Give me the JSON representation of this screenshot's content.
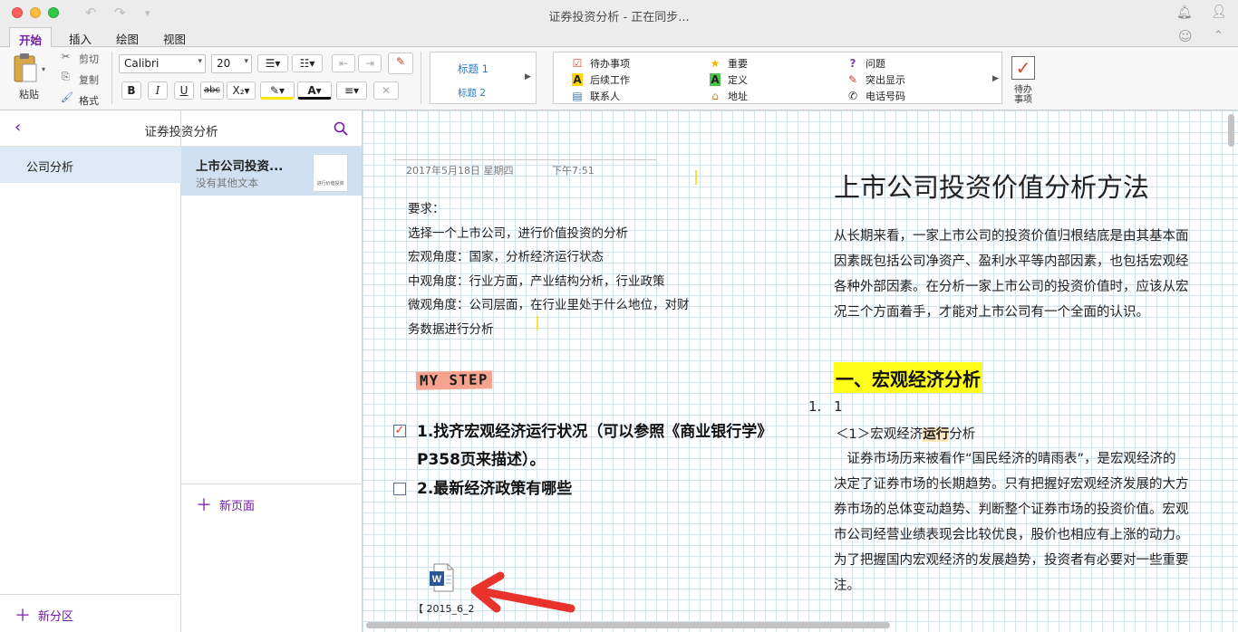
{
  "window": {
    "title": "证券投资分析 - 正在同步..."
  },
  "ribbon_tabs": [
    "开始",
    "插入",
    "绘图",
    "视图"
  ],
  "ribbon": {
    "paste": "粘贴",
    "cut": "剪切",
    "copy": "复制",
    "format": "格式",
    "font": "Calibri",
    "font_size": "20",
    "styles": [
      "标题 1",
      "标题 2"
    ],
    "tags": [
      {
        "icon": "checkbox-icon",
        "label": "待办事项"
      },
      {
        "icon": "star-icon",
        "label": "重要"
      },
      {
        "icon": "question-icon",
        "label": "问题"
      },
      {
        "icon": "letter-a-icon",
        "label": "后续工作"
      },
      {
        "icon": "letter-a-green-icon",
        "label": "定义"
      },
      {
        "icon": "highlighter-icon",
        "label": "突出显示"
      },
      {
        "icon": "contact-card-icon",
        "label": "联系人"
      },
      {
        "icon": "house-icon",
        "label": "地址"
      },
      {
        "icon": "phone-icon",
        "label": "电话号码"
      }
    ],
    "todo_button": "待办事项"
  },
  "nav": {
    "notebook": "证券投资分析",
    "sections": [
      "公司分析"
    ],
    "pages": [
      {
        "title": "上市公司投资...",
        "subtitle": "没有其他文本",
        "thumb": "进行价值投资"
      }
    ],
    "add_section": "新分区",
    "add_page": "新页面"
  },
  "page": {
    "date": "2017年5月18日 星期四",
    "time": "下午7:51",
    "requirements": [
      "要求：",
      "选择一个上市公司，进行价值投资的分析",
      "宏观角度：国家，分析经济运行状态",
      "中观角度：行业方面，产业结构分析，行业政策",
      "微观角度：公司层面，在行业里处于什么地位，对财",
      "务数据进行分析"
    ],
    "mystep": "MY STEP",
    "todos": [
      {
        "checked": true,
        "text": "1.找齐宏观经济运行状况（可以参照《商业银行学》P358页来描述）。"
      },
      {
        "checked": false,
        "text": "2.最新经济政策有哪些"
      }
    ],
    "attachment": "【 2015_6_2",
    "doc_title": "上市公司投资价值分析方法",
    "intro": [
      "从长期来看，一家上市公司的投资价值归根结底是由其基本面",
      "因素既包括公司净资产、盈利水平等内部因素，也包括宏观经",
      "各种外部因素。在分析一家上市公司的投资价值时，应该从宏",
      "况三个方面着手，才能对上市公司有一个全面的认识。"
    ],
    "h1": "一、宏观经济分析",
    "list_number": "1.",
    "list_value": "1",
    "subhead_pre": "＜1＞宏观经济",
    "subhead_bold": "运行",
    "subhead_post": "分析",
    "body": [
      "　证券市场历来被看作“国民经济的晴雨表”，是宏观经济的",
      "决定了证券市场的长期趋势。只有把握好宏观经济发展的大方",
      "券市场的总体变动趋势、判断整个证券市场的投资价值。宏观",
      "市公司经营业绩表现会比较优良，股价也相应有上涨的动力。",
      "为了把握国内宏观经济的发展趋势，投资者有必要对一些重要",
      "注。"
    ]
  }
}
